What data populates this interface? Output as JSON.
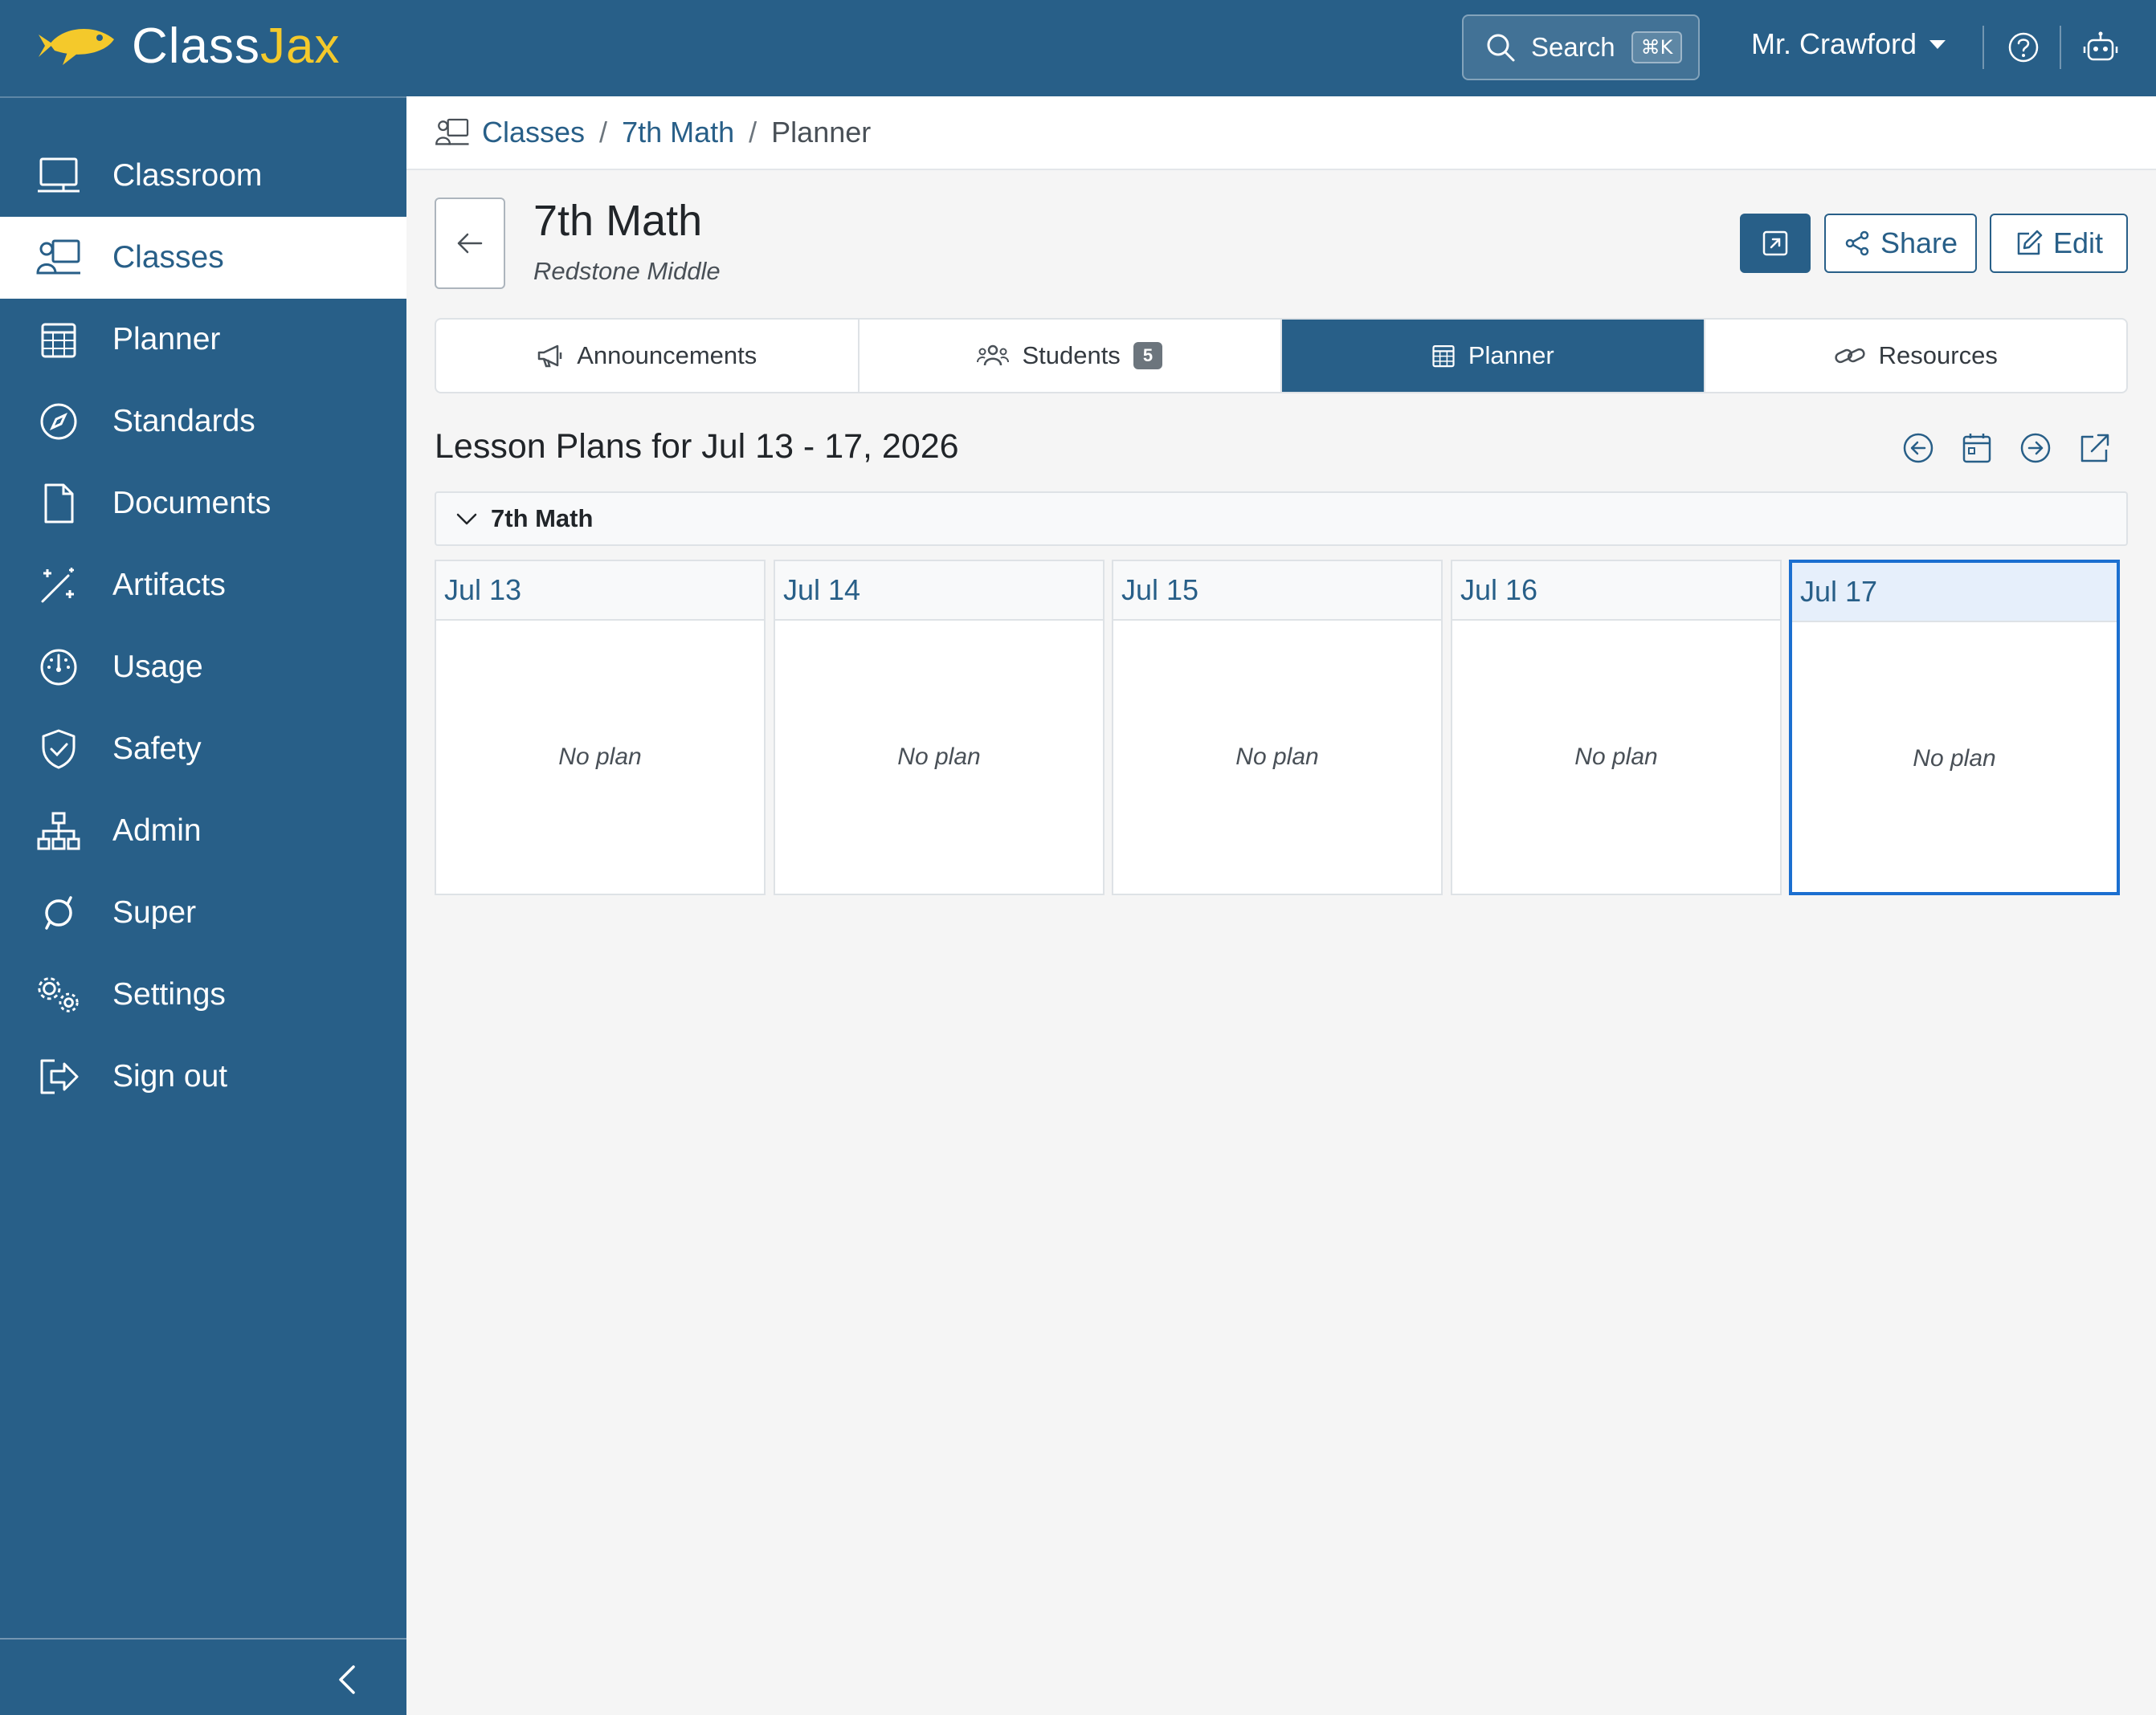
{
  "app": {
    "brand_part1": "Class",
    "brand_part2": "Jax",
    "brand_accent_color": "#f4c92b",
    "primary_color": "#285f88",
    "search": {
      "label": "Search",
      "shortcut": "⌘K"
    },
    "user_name": "Mr. Crawford"
  },
  "sidebar": {
    "items": [
      {
        "label": "Classroom",
        "icon": "classroom-icon"
      },
      {
        "label": "Classes",
        "icon": "classes-icon",
        "active": true
      },
      {
        "label": "Planner",
        "icon": "calendar-icon"
      },
      {
        "label": "Standards",
        "icon": "compass-icon"
      },
      {
        "label": "Documents",
        "icon": "document-icon"
      },
      {
        "label": "Artifacts",
        "icon": "magic-wand-icon"
      },
      {
        "label": "Usage",
        "icon": "speedometer-icon"
      },
      {
        "label": "Safety",
        "icon": "shield-check-icon"
      },
      {
        "label": "Admin",
        "icon": "org-chart-icon"
      },
      {
        "label": "Super",
        "icon": "super-icon"
      },
      {
        "label": "Settings",
        "icon": "gears-icon"
      },
      {
        "label": "Sign out",
        "icon": "sign-out-icon"
      }
    ]
  },
  "breadcrumb": {
    "items": [
      "Classes",
      "7th Math"
    ],
    "current": "Planner",
    "separator": "/"
  },
  "header": {
    "title": "7th Math",
    "subtitle": "Redstone Middle",
    "share_label": "Share",
    "edit_label": "Edit"
  },
  "tabs": [
    {
      "label": "Announcements",
      "icon": "megaphone-icon"
    },
    {
      "label": "Students",
      "icon": "people-icon",
      "badge": "5"
    },
    {
      "label": "Planner",
      "icon": "calendar-icon",
      "active": true
    },
    {
      "label": "Resources",
      "icon": "link-icon"
    }
  ],
  "planner": {
    "title": "Lesson Plans for Jul 13 - 17, 2026",
    "group_label": "7th Math",
    "days": [
      {
        "date": "Jul 13",
        "status": "No plan"
      },
      {
        "date": "Jul 14",
        "status": "No plan"
      },
      {
        "date": "Jul 15",
        "status": "No plan"
      },
      {
        "date": "Jul 16",
        "status": "No plan"
      },
      {
        "date": "Jul 17",
        "status": "No plan",
        "today": true
      }
    ]
  }
}
